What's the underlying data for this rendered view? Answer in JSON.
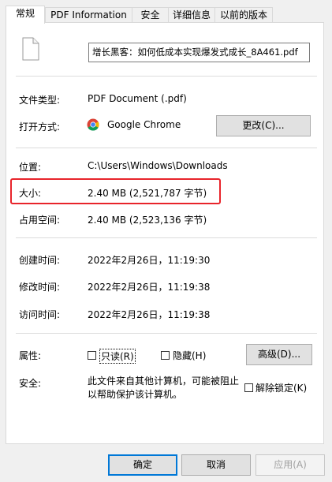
{
  "tabs": [
    "常规",
    "PDF Information",
    "安全",
    "详细信息",
    "以前的版本"
  ],
  "file": {
    "name": "增长黑客：如何低成本实现爆发式成长_8A461.pdf",
    "icon": "file-icon"
  },
  "type": {
    "label": "文件类型:",
    "value": "PDF Document (.pdf)"
  },
  "opens_with": {
    "label": "打开方式:",
    "value": "Google Chrome",
    "icon": "chrome-icon",
    "button": "更改(C)..."
  },
  "location": {
    "label": "位置:",
    "value": "C:\\Users\\Windows\\Downloads"
  },
  "size": {
    "label": "大小:",
    "value": "2.40 MB (2,521,787 字节)"
  },
  "size_on_disk": {
    "label": "占用空间:",
    "value": "2.40 MB (2,523,136 字节)"
  },
  "created": {
    "label": "创建时间:",
    "value": "2022年2月26日，11:19:30"
  },
  "modified": {
    "label": "修改时间:",
    "value": "2022年2月26日，11:19:38"
  },
  "accessed": {
    "label": "访问时间:",
    "value": "2022年2月26日，11:19:38"
  },
  "attributes": {
    "label": "属性:",
    "readonly": "只读(R)",
    "hidden": "隐藏(H)",
    "advanced": "高级(D)..."
  },
  "security": {
    "label": "安全:",
    "message": "此文件来自其他计算机，可能被阻止以帮助保护该计算机。",
    "unblock": "解除锁定(K)"
  },
  "footer": {
    "ok": "确定",
    "cancel": "取消",
    "apply": "应用(A)"
  },
  "colors": {
    "highlight": "#e8242b",
    "accent": "#0078d7"
  }
}
